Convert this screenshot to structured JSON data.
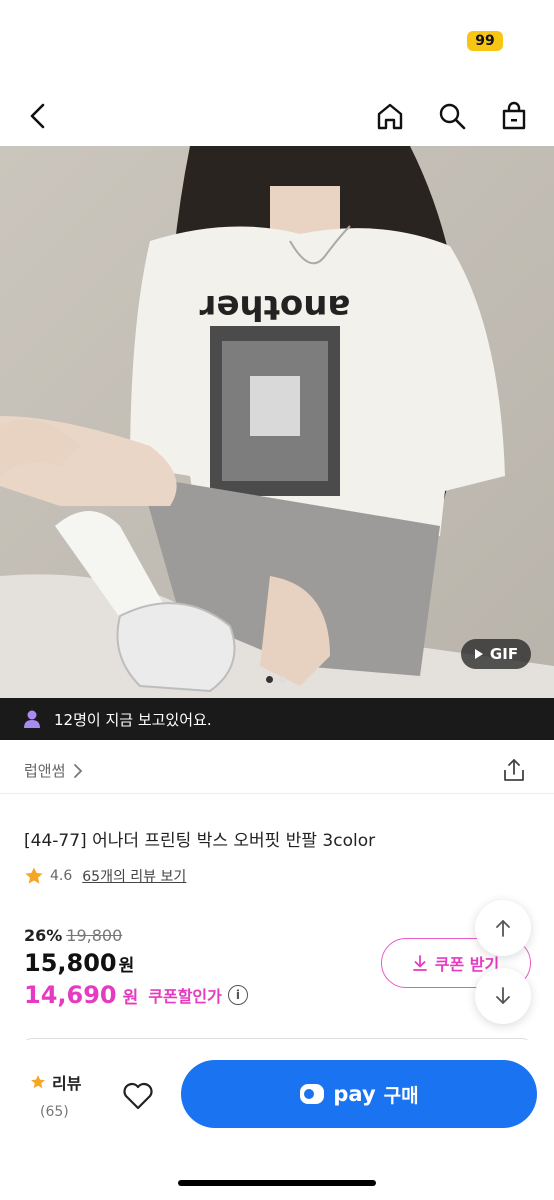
{
  "status": {
    "badge": "99"
  },
  "gallery": {
    "gif_label": "GIF",
    "page_count": 2,
    "current_page": 1
  },
  "viewers": {
    "text": "12명이 지금 보고있어요."
  },
  "brand": {
    "name": "럽앤썸"
  },
  "product": {
    "title": "[44-77] 어나더 프린팅 박스 오버핏 반팔 3color",
    "rating": "4.6",
    "review_link": "65개의 리뷰 보기",
    "discount_pct": "26%",
    "original_price": "19,800",
    "price": "15,800",
    "price_unit": "원",
    "coupon_price": "14,690",
    "coupon_unit": "원",
    "coupon_label": "쿠폰할인가"
  },
  "coupon_button": {
    "label": "쿠폰 받기"
  },
  "bottom": {
    "review_label": "리뷰",
    "review_count": "(65)",
    "pay_label": "pay",
    "buy_label": "구매"
  },
  "colors": {
    "accent_pink": "#e63bc0",
    "buy_blue": "#1a73f0",
    "star": "#f5a623"
  }
}
